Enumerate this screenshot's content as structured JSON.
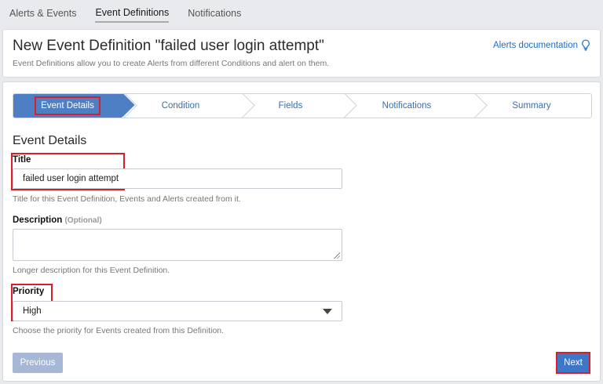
{
  "top_nav": {
    "items": [
      "Alerts & Events",
      "Event Definitions",
      "Notifications"
    ],
    "active_index": 1
  },
  "header": {
    "title": "New Event Definition \"failed user login attempt\"",
    "subtitle": "Event Definitions allow you to create Alerts from different Conditions and alert on them.",
    "doc_link": "Alerts documentation",
    "doc_icon": "lightbulb-icon"
  },
  "steps": [
    "Event Details",
    "Condition",
    "Fields",
    "Notifications",
    "Summary"
  ],
  "active_step": 0,
  "form": {
    "section_title": "Event Details",
    "title_label": "Title",
    "title_value": "failed user login attempt",
    "title_help": "Title for this Event Definition, Events and Alerts created from it.",
    "description_label": "Description",
    "description_optional": "(Optional)",
    "description_value": "",
    "description_help": "Longer description for this Event Definition.",
    "priority_label": "Priority",
    "priority_value": "High",
    "priority_help": "Choose the priority for Events created from this Definition."
  },
  "buttons": {
    "previous": "Previous",
    "next": "Next"
  },
  "colors": {
    "accent": "#3f77c8",
    "annotation_red": "#d4202a",
    "link": "#1f6fbf"
  }
}
